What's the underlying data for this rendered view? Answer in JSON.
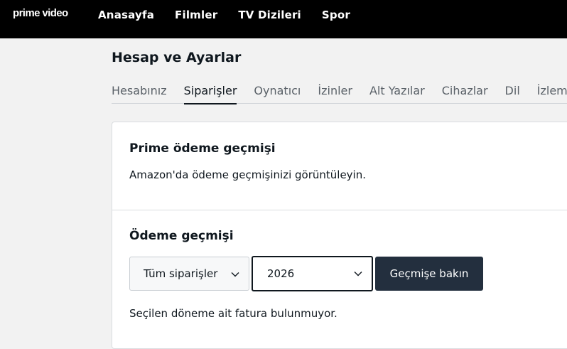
{
  "brand": {
    "logo_text": "prime video"
  },
  "nav": {
    "items": [
      {
        "label": "Anasayfa"
      },
      {
        "label": "Filmler"
      },
      {
        "label": "TV Dizileri"
      },
      {
        "label": "Spor"
      }
    ]
  },
  "page": {
    "title": "Hesap ve Ayarlar"
  },
  "tabs": [
    {
      "label": "Hesabınız",
      "active": false
    },
    {
      "label": "Siparişler",
      "active": true
    },
    {
      "label": "Oynatıcı",
      "active": false
    },
    {
      "label": "İzinler",
      "active": false
    },
    {
      "label": "Alt Yazılar",
      "active": false
    },
    {
      "label": "Cihazlar",
      "active": false
    },
    {
      "label": "Dil",
      "active": false
    },
    {
      "label": "İzleme",
      "active": false
    }
  ],
  "billing": {
    "title": "Prime ödeme geçmişi",
    "description": "Amazon'da ödeme geçmişinizi görüntüleyin."
  },
  "history": {
    "title": "Ödeme geçmişi",
    "orders_select": {
      "value": "Tüm siparişler",
      "icon": "chevron-down-icon"
    },
    "year_select": {
      "value": "2026",
      "icon": "chevron-down-icon"
    },
    "submit_label": "Geçmişe bakın",
    "empty_message": "Seçilen döneme ait fatura bulunmuyor."
  },
  "colors": {
    "topbar": "#000000",
    "button": "#232f3e",
    "background": "#f2f2f2"
  }
}
